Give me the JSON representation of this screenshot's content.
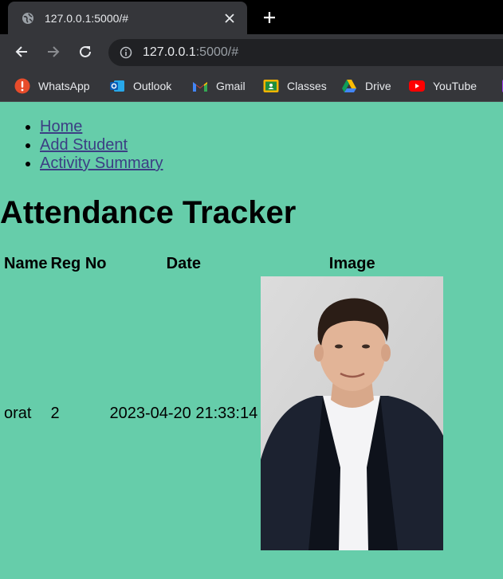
{
  "browser": {
    "tab": {
      "title": "127.0.0.1:5000/#",
      "favicon": "globe-icon"
    },
    "address": {
      "host": "127.0.0.1",
      "path": ":5000/#"
    },
    "bookmarks": [
      {
        "label": "WhatsApp",
        "icon": "whatsapp-icon"
      },
      {
        "label": "Outlook",
        "icon": "outlook-icon"
      },
      {
        "label": "Gmail",
        "icon": "gmail-icon"
      },
      {
        "label": "Classes",
        "icon": "classroom-icon"
      },
      {
        "label": "Drive",
        "icon": "drive-icon"
      },
      {
        "label": "YouTube",
        "icon": "youtube-icon"
      }
    ]
  },
  "nav": {
    "links": [
      {
        "label": "Home"
      },
      {
        "label": "Add Student"
      },
      {
        "label": "Activity Summary"
      }
    ]
  },
  "heading": "Attendance Tracker",
  "table": {
    "headers": [
      "Name",
      "Reg No",
      "Date",
      "Image"
    ],
    "rows": [
      {
        "name": "orat",
        "reg_no": "2",
        "date": "2023-04-20 21:33:14",
        "image": "student-photo"
      }
    ]
  },
  "colors": {
    "page_background": "#66cdaa",
    "link": "#3c3e84",
    "chrome_dark": "#35363a"
  }
}
